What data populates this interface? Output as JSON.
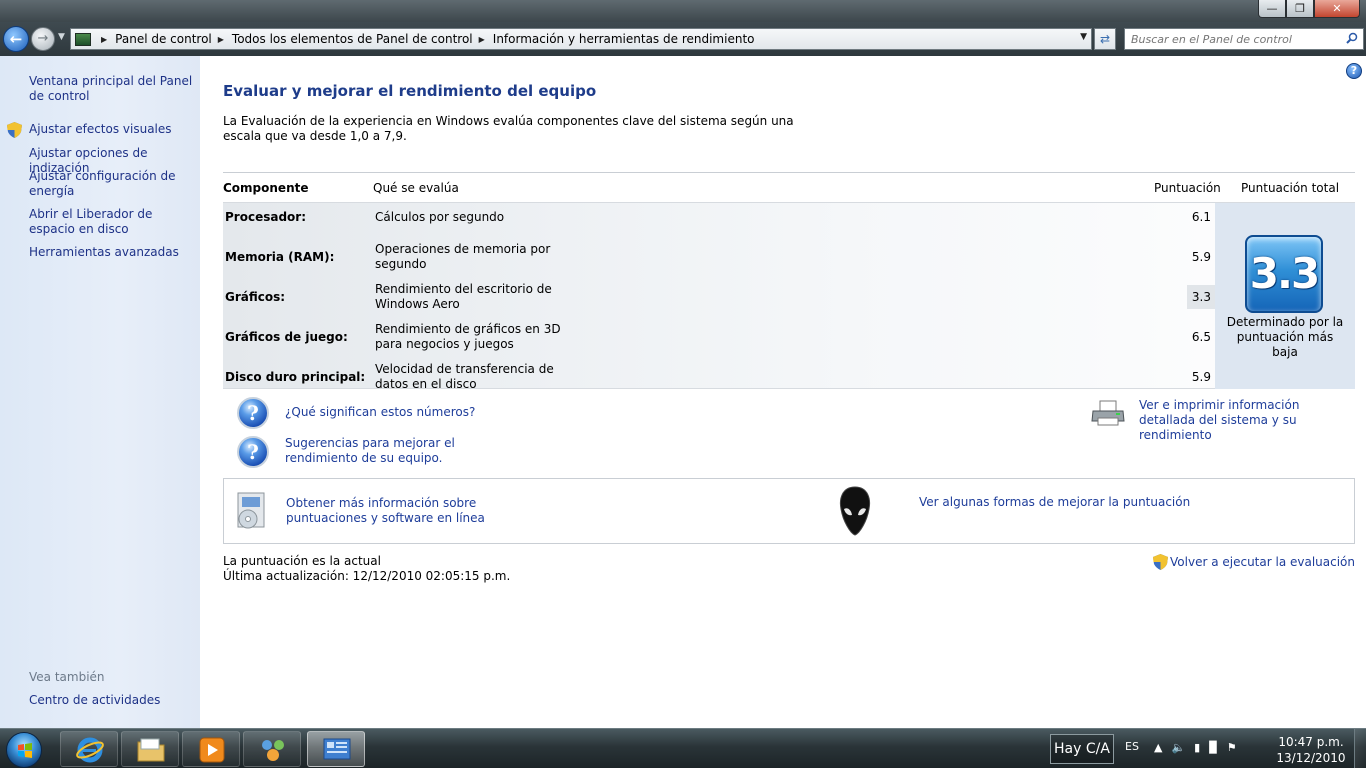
{
  "address": {
    "crumbs": [
      "Panel de control",
      "Todos los elementos de Panel de control",
      "Información y herramientas de rendimiento"
    ],
    "search_placeholder": "Buscar en el Panel de control"
  },
  "sidebar": {
    "links": [
      {
        "label": "Ventana principal del Panel de control"
      },
      {
        "label": "Ajustar efectos visuales"
      },
      {
        "label": "Ajustar opciones de indización"
      },
      {
        "label": "Ajustar configuración de energía"
      },
      {
        "label": "Abrir el Liberador de espacio en disco"
      },
      {
        "label": "Herramientas avanzadas"
      }
    ],
    "see_also_title": "Vea también",
    "see_also_links": [
      {
        "label": "Centro de actividades"
      }
    ]
  },
  "main": {
    "title": "Evaluar y mejorar el rendimiento del equipo",
    "intro": "La Evaluación de la experiencia en Windows evalúa componentes clave del sistema según una escala que va desde 1,0 a 7,9.",
    "table": {
      "headers": {
        "component": "Componente",
        "what": "Qué se evalúa",
        "score": "Puntuación",
        "total": "Puntuación total"
      },
      "rows": [
        {
          "component": "Procesador:",
          "what": "Cálculos por segundo",
          "score": "6.1"
        },
        {
          "component": "Memoria (RAM):",
          "what": "Operaciones de memoria por segundo",
          "score": "5.9"
        },
        {
          "component": "Gráficos:",
          "what": "Rendimiento del escritorio de Windows Aero",
          "score": "3.3"
        },
        {
          "component": "Gráficos de juego:",
          "what": "Rendimiento de gráficos en 3D para negocios y juegos",
          "score": "6.5"
        },
        {
          "component": "Disco duro principal:",
          "what": "Velocidad de transferencia de datos en el disco",
          "score": "5.9"
        }
      ],
      "total_score": "3.3",
      "total_caption": "Determinado por la puntuación más baja"
    },
    "links": {
      "what_numbers": "¿Qué significan estos números?",
      "suggestions": "Sugerencias para mejorar el rendimiento de su equipo.",
      "print_details": "Ver e imprimir información detallada del sistema y su rendimiento",
      "more_info": "Obtener más información sobre puntuaciones y software en línea",
      "improve_score": "Ver algunas formas de mejorar la puntuación",
      "rerun": "Volver a ejecutar la evaluación"
    },
    "status": {
      "current": "La puntuación es la actual",
      "last_update": "Última actualización: 12/12/2010 02:05:15 p.m."
    }
  },
  "taskbar": {
    "notice": "Hay C/A",
    "language": "ES",
    "time": "10:47 p.m.",
    "date": "13/12/2010"
  },
  "colors": {
    "link": "#1e3d9a",
    "title": "#1e3c8a",
    "sidebar_bg": "#e4ecf7",
    "score_badge": "#2f8fd6"
  },
  "icons": [
    "back-icon",
    "forward-icon",
    "control-panel-icon",
    "refresh-icon",
    "search-icon",
    "help-icon",
    "shield-icon",
    "question-icon",
    "printer-icon",
    "software-disc-icon",
    "alienware-icon",
    "windows-flag-icon",
    "internet-explorer-icon",
    "folder-icon",
    "media-player-icon",
    "network-icon",
    "performance-icon"
  ]
}
